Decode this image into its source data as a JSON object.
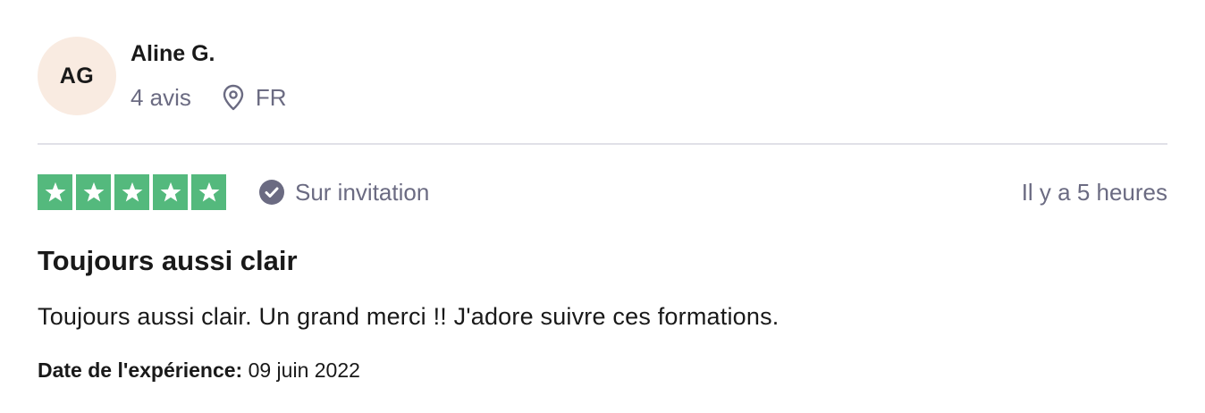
{
  "reviewer": {
    "initials": "AG",
    "name": "Aline G.",
    "review_count": "4 avis",
    "country": "FR",
    "avatar_color": "#f9ebe1"
  },
  "rating": {
    "stars": 5,
    "max_stars": 5,
    "star_color": "#54b97d",
    "verification": "Sur invitation",
    "time_ago": "Il y a 5 heures"
  },
  "review": {
    "title": "Toujours aussi clair",
    "body": "Toujours aussi clair. Un grand merci !! J'adore suivre ces formations.",
    "experience_label": "Date de l'expérience:",
    "experience_date": "09 juin 2022"
  },
  "icons": {
    "location": "location-pin-icon",
    "verified": "check-circle-icon",
    "star": "star-icon"
  }
}
